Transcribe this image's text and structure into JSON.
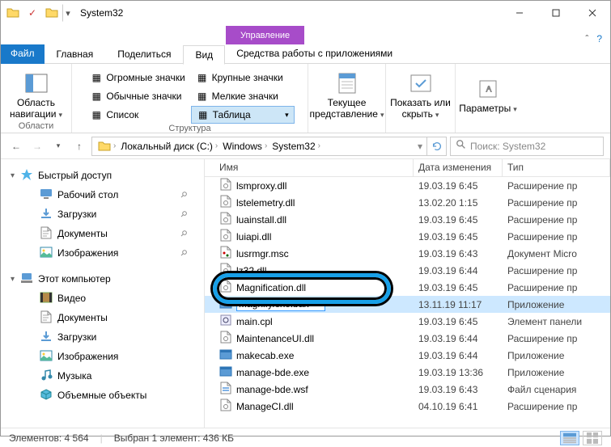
{
  "title": "System32",
  "ribbon": {
    "context_tab": "Управление",
    "file": "Файл",
    "tabs": [
      {
        "label": "Главная",
        "active": false
      },
      {
        "label": "Поделиться",
        "active": false
      },
      {
        "label": "Вид",
        "active": true
      }
    ],
    "context_sub": "Средства работы с приложениями",
    "groups": {
      "areas": {
        "nav_panel": "Область навигации",
        "label": "Области"
      },
      "layout": {
        "items": [
          "Огромные значки",
          "Крупные значки",
          "Обычные значки",
          "Мелкие значки",
          "Список",
          "Таблица"
        ],
        "selected": "Таблица",
        "label": "Структура"
      },
      "current_view": {
        "label": "Текущее представление"
      },
      "show_hide": {
        "label": "Показать или скрыть"
      },
      "options": {
        "label": "Параметры"
      }
    }
  },
  "breadcrumb": [
    "Локальный диск (C:)",
    "Windows",
    "System32"
  ],
  "search_placeholder": "Поиск: System32",
  "columns": {
    "name": "Имя",
    "date": "Дата изменения",
    "type": "Тип"
  },
  "nav": {
    "quick": "Быстрый доступ",
    "quick_items": [
      {
        "name": "Рабочий стол",
        "icon": "desktop",
        "pin": true
      },
      {
        "name": "Загрузки",
        "icon": "downloads",
        "pin": true
      },
      {
        "name": "Документы",
        "icon": "documents",
        "pin": true
      },
      {
        "name": "Изображения",
        "icon": "pictures",
        "pin": true
      }
    ],
    "thispc": "Этот компьютер",
    "pc_items": [
      {
        "name": "Видео",
        "icon": "video"
      },
      {
        "name": "Документы",
        "icon": "documents"
      },
      {
        "name": "Загрузки",
        "icon": "downloads"
      },
      {
        "name": "Изображения",
        "icon": "pictures"
      },
      {
        "name": "Музыка",
        "icon": "music"
      },
      {
        "name": "Объемные объекты",
        "icon": "3d"
      }
    ]
  },
  "files": [
    {
      "i": "dll",
      "name": "lsmproxy.dll",
      "date": "19.03.19 6:45",
      "type": "Расширение пр"
    },
    {
      "i": "dll",
      "name": "lstelemetry.dll",
      "date": "13.02.20 1:15",
      "type": "Расширение пр"
    },
    {
      "i": "dll",
      "name": "luainstall.dll",
      "date": "19.03.19 6:45",
      "type": "Расширение пр"
    },
    {
      "i": "dll",
      "name": "luiapi.dll",
      "date": "19.03.19 6:45",
      "type": "Расширение пр"
    },
    {
      "i": "msc",
      "name": "lusrmgr.msc",
      "date": "19.03.19 6:43",
      "type": "Документ Micro"
    },
    {
      "i": "dll",
      "name": "lz32.dll",
      "date": "19.03.19 6:44",
      "type": "Расширение пр"
    },
    {
      "i": "dll",
      "name": "Magnification.dll",
      "date": "19.03.19 6:45",
      "type": "Расширение пр"
    },
    {
      "i": "exe",
      "name": "Magnify.exe.bak",
      "date": "13.11.19 11:17",
      "type": "Приложение",
      "selected": true,
      "rename": true
    },
    {
      "i": "cpl",
      "name": "main.cpl",
      "date": "19.03.19 6:45",
      "type": "Элемент панели"
    },
    {
      "i": "dll",
      "name": "MaintenanceUI.dll",
      "date": "19.03.19 6:44",
      "type": "Расширение пр"
    },
    {
      "i": "exe",
      "name": "makecab.exe",
      "date": "19.03.19 6:44",
      "type": "Приложение"
    },
    {
      "i": "exe",
      "name": "manage-bde.exe",
      "date": "19.03.19 13:36",
      "type": "Приложение"
    },
    {
      "i": "wsf",
      "name": "manage-bde.wsf",
      "date": "19.03.19 6:43",
      "type": "Файл сценария"
    },
    {
      "i": "dll",
      "name": "ManageCI.dll",
      "date": "04.10.19 6:41",
      "type": "Расширение пр"
    }
  ],
  "status": {
    "count_label": "Элементов:",
    "count": "4 564",
    "sel": "Выбран 1 элемент: 436 КБ"
  }
}
